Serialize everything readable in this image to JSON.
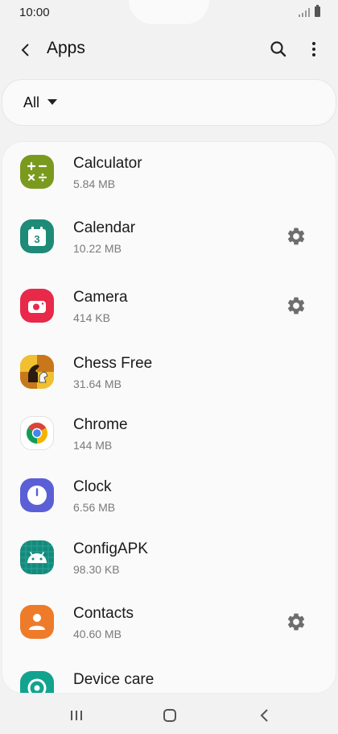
{
  "status_bar": {
    "time": "10:00"
  },
  "header": {
    "title": "Apps"
  },
  "filter": {
    "label": "All"
  },
  "apps": [
    {
      "name": "Calculator",
      "size": "5.84 MB",
      "icon": "calculator-icon",
      "color": "#7a9a1e",
      "settings": false
    },
    {
      "name": "Calendar",
      "size": "10.22 MB",
      "icon": "calendar-icon",
      "color": "#1e8a78",
      "settings": true,
      "day": "3"
    },
    {
      "name": "Camera",
      "size": "414 KB",
      "icon": "camera-icon",
      "color": "#e8294a",
      "settings": true
    },
    {
      "name": "Chess Free",
      "size": "31.64 MB",
      "icon": "chess-icon",
      "color": "#e2a312",
      "settings": false
    },
    {
      "name": "Chrome",
      "size": "144 MB",
      "icon": "chrome-icon",
      "color": "#ffffff",
      "settings": false
    },
    {
      "name": "Clock",
      "size": "6.56 MB",
      "icon": "clock-icon",
      "color": "#5b5fd6",
      "settings": false
    },
    {
      "name": "ConfigAPK",
      "size": "98.30 KB",
      "icon": "android-icon",
      "color": "#138a7c",
      "settings": false
    },
    {
      "name": "Contacts",
      "size": "40.60 MB",
      "icon": "contacts-icon",
      "color": "#ee7b2a",
      "settings": true
    },
    {
      "name": "Device care",
      "size": "",
      "icon": "device-care-icon",
      "color": "#12a38e",
      "settings": false
    }
  ]
}
